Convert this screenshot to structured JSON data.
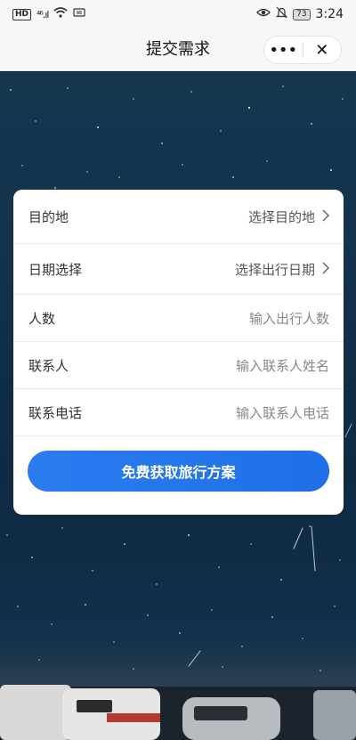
{
  "status_bar": {
    "hd_badge": "HD",
    "signal": "⁴⁶.ıl",
    "battery": "73",
    "time": "3:24",
    "icons": [
      "hd-icon",
      "signal-icon",
      "wifi-icon",
      "eye-icon",
      "mute-icon",
      "battery-icon"
    ]
  },
  "nav": {
    "title": "提交需求",
    "more_label": "•••",
    "close_label": "✕"
  },
  "form": {
    "rows": [
      {
        "label": "目的地",
        "value": "选择目的地",
        "type": "select"
      },
      {
        "label": "日期选择",
        "value": "选择出行日期",
        "type": "select"
      },
      {
        "label": "人数",
        "placeholder": "输入出行人数",
        "type": "input"
      },
      {
        "label": "联系人",
        "placeholder": "输入联系人姓名",
        "type": "input"
      },
      {
        "label": "联系电话",
        "placeholder": "输入联系人电话",
        "type": "input"
      }
    ],
    "submit_label": "免费获取旅行方案"
  },
  "colors": {
    "accent": "#2b7cf1",
    "sky": "#12304a"
  }
}
